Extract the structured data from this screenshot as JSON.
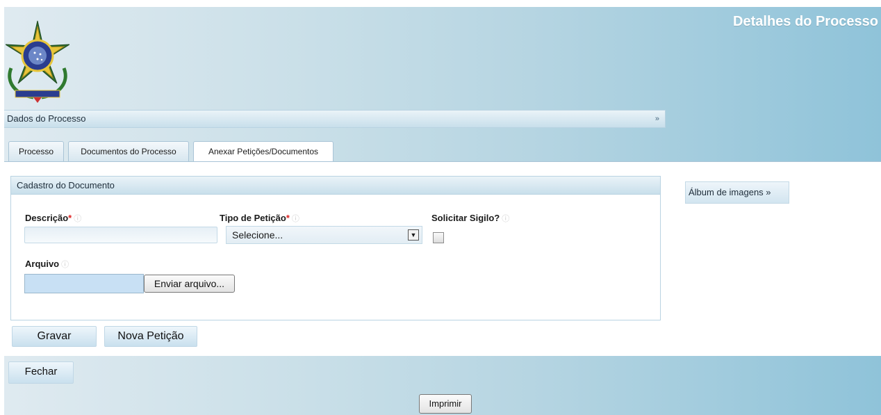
{
  "header": {
    "title": "Detalhes do Processo"
  },
  "section_bar": {
    "label": "Dados do Processo",
    "arrow": "»"
  },
  "tabs": [
    {
      "label": "Processo",
      "active": false
    },
    {
      "label": "Documentos do Processo",
      "active": false
    },
    {
      "label": "Anexar Petições/Documentos",
      "active": true
    }
  ],
  "panel": {
    "title": "Cadastro do Documento"
  },
  "form": {
    "descricao": {
      "label": "Descrição",
      "required": "*",
      "hint": "ⓘ",
      "value": ""
    },
    "tipo_peticao": {
      "label": "Tipo de Petição",
      "required": "*",
      "hint": "ⓘ",
      "selected": "Selecione...",
      "dropdown_glyph": "▼"
    },
    "sigilo": {
      "label": "Solicitar Sigilo?",
      "hint": "ⓘ",
      "checked": false
    },
    "arquivo": {
      "label": "Arquivo",
      "hint": "ⓘ",
      "value": "",
      "button_label": "Enviar arquivo..."
    }
  },
  "actions": {
    "save_label": "Gravar",
    "new_label": "Nova Petição"
  },
  "album": {
    "label": "Álbum de imagens »"
  },
  "footer": {
    "close_label": "Fechar",
    "print_label": "Imprimir"
  },
  "colors": {
    "accent_blue": "#8fc3d9",
    "required": "#dd2222",
    "file_input": "#c8e0f4"
  }
}
